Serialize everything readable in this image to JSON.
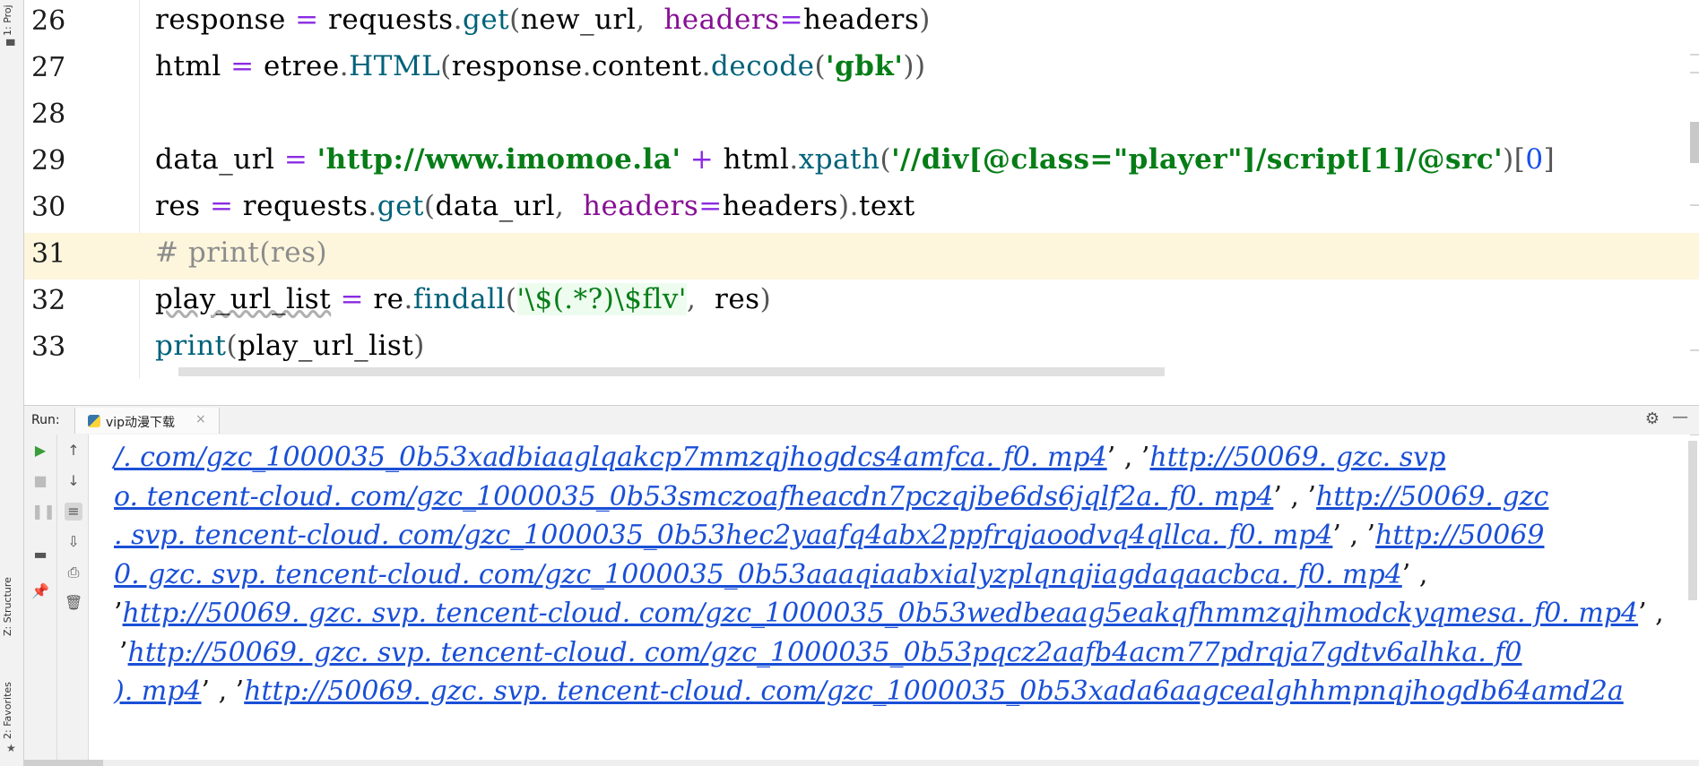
{
  "side_panel": {
    "project_label": "1: Proj",
    "structure_label": "Z: Structure",
    "favorites_label": "2: Favorites"
  },
  "editor": {
    "lines": [
      {
        "num": "26",
        "tokens": [
          {
            "t": "response ",
            "c": "kw"
          },
          {
            "t": "= ",
            "c": "op"
          },
          {
            "t": "requests",
            "c": "kw"
          },
          {
            "t": ".",
            "c": "punc"
          },
          {
            "t": "get",
            "c": "fn"
          },
          {
            "t": "(",
            "c": "punc"
          },
          {
            "t": "new_url",
            "c": "kw"
          },
          {
            "t": ",  ",
            "c": "punc"
          },
          {
            "t": "headers",
            "c": "param"
          },
          {
            "t": "=",
            "c": "op"
          },
          {
            "t": "headers",
            "c": "kw"
          },
          {
            "t": ")",
            "c": "punc"
          }
        ]
      },
      {
        "num": "27",
        "tokens": [
          {
            "t": "html ",
            "c": "kw"
          },
          {
            "t": "= ",
            "c": "op"
          },
          {
            "t": "etree",
            "c": "kw"
          },
          {
            "t": ".",
            "c": "punc"
          },
          {
            "t": "HTML",
            "c": "fn"
          },
          {
            "t": "(",
            "c": "punc"
          },
          {
            "t": "response",
            "c": "kw"
          },
          {
            "t": ".",
            "c": "punc"
          },
          {
            "t": "content",
            "c": "kw"
          },
          {
            "t": ".",
            "c": "punc"
          },
          {
            "t": "decode",
            "c": "fn"
          },
          {
            "t": "(",
            "c": "punc"
          },
          {
            "t": "'gbk'",
            "c": "str"
          },
          {
            "t": "))",
            "c": "punc"
          }
        ]
      },
      {
        "num": "28",
        "tokens": []
      },
      {
        "num": "29",
        "tokens": [
          {
            "t": "data_url ",
            "c": "kw"
          },
          {
            "t": "= ",
            "c": "op"
          },
          {
            "t": "'http://www.imomoe.la'",
            "c": "str"
          },
          {
            "t": " + ",
            "c": "op"
          },
          {
            "t": "html",
            "c": "kw"
          },
          {
            "t": ".",
            "c": "punc"
          },
          {
            "t": "xpath",
            "c": "fn"
          },
          {
            "t": "(",
            "c": "punc"
          },
          {
            "t": "'//div[@class=\"player\"]/script[1]/@src'",
            "c": "str"
          },
          {
            "t": ")[",
            "c": "punc"
          },
          {
            "t": "0",
            "c": "num"
          },
          {
            "t": "]",
            "c": "punc"
          }
        ]
      },
      {
        "num": "30",
        "tokens": [
          {
            "t": "res ",
            "c": "kw"
          },
          {
            "t": "= ",
            "c": "op"
          },
          {
            "t": "requests",
            "c": "kw"
          },
          {
            "t": ".",
            "c": "punc"
          },
          {
            "t": "get",
            "c": "fn"
          },
          {
            "t": "(",
            "c": "punc"
          },
          {
            "t": "data_url",
            "c": "kw"
          },
          {
            "t": ",  ",
            "c": "punc"
          },
          {
            "t": "headers",
            "c": "param"
          },
          {
            "t": "=",
            "c": "op"
          },
          {
            "t": "headers",
            "c": "kw"
          },
          {
            "t": ")",
            "c": "punc"
          },
          {
            "t": ".",
            "c": "punc"
          },
          {
            "t": "text",
            "c": "kw"
          }
        ]
      },
      {
        "num": "31",
        "current": true,
        "tokens": [
          {
            "t": "# print(res)",
            "c": "cmt"
          }
        ]
      },
      {
        "num": "32",
        "tokens": [
          {
            "t": "play_url_list",
            "c": "kw squig"
          },
          {
            "t": " = ",
            "c": "op"
          },
          {
            "t": "re",
            "c": "kw"
          },
          {
            "t": ".",
            "c": "punc"
          },
          {
            "t": "findall",
            "c": "fn"
          },
          {
            "t": "(",
            "c": "punc"
          },
          {
            "t": "'\\$(.*?)\\$flv'",
            "c": "re"
          },
          {
            "t": ",  ",
            "c": "punc"
          },
          {
            "t": "res",
            "c": "kw"
          },
          {
            "t": ")",
            "c": "punc"
          }
        ]
      },
      {
        "num": "33",
        "tokens": [
          {
            "t": "print",
            "c": "fn"
          },
          {
            "t": "(",
            "c": "punc"
          },
          {
            "t": "play_url_list",
            "c": "kw"
          },
          {
            "t": ")",
            "c": "punc"
          }
        ]
      }
    ]
  },
  "run_panel": {
    "label": "Run:",
    "tab_name": "vip动漫下载",
    "tab_close": "×",
    "gear": "⚙",
    "minimize": "—"
  },
  "console": {
    "lines": [
      {
        "x": 28,
        "parts": [
          {
            "t": "/. com/gzc_1000035_0b53xadbiaaglqakcp7mmzqjhogdcs4amfca. f0. mp4",
            "c": "link"
          },
          {
            "t": "’ , ’",
            "c": "sep"
          },
          {
            "t": "http://50069. gzc. svp",
            "c": "link"
          }
        ]
      },
      {
        "x": 28,
        "parts": [
          {
            "t": "o. tencent-cloud. com/gzc_1000035_0b53smczoafheacdn7pczqjbe6ds6jqlf2a. f0. mp4",
            "c": "link"
          },
          {
            "t": "’ , ’",
            "c": "sep"
          },
          {
            "t": "http://50069. gzc",
            "c": "link"
          }
        ]
      },
      {
        "x": 28,
        "parts": [
          {
            "t": ". svp. tencent-cloud. com/gzc_1000035_0b53hec2yaafq4abx2ppfrqjaoodvq4qllca. f0. mp4",
            "c": "link"
          },
          {
            "t": "’ , ’",
            "c": "sep"
          },
          {
            "t": "http://50069",
            "c": "link"
          }
        ]
      },
      {
        "x": 28,
        "parts": [
          {
            "t": "0. gzc. svp. tencent-cloud. com/gzc_1000035_0b53aaaqiaabxialyzplqnqjiagdaqaacbca. f0. mp4",
            "c": "link"
          },
          {
            "t": "’ ,",
            "c": "sep"
          }
        ]
      },
      {
        "x": 28,
        "parts": [
          {
            "t": "’",
            "c": "sep"
          },
          {
            "t": "http://50069. gzc. svp. tencent-cloud. com/gzc_1000035_0b53wedbeaag5eakqfhmmzqjhmodckyqmesa. f0. mp4",
            "c": "link"
          },
          {
            "t": "’ ,",
            "c": "sep"
          }
        ]
      },
      {
        "x": 34,
        "parts": [
          {
            "t": "’",
            "c": "sep"
          },
          {
            "t": "http://50069. gzc. svp. tencent-cloud. com/gzc_1000035_0b53pqcz2aafb4acm77pdrqja7gdtv6alhka. f0",
            "c": "link"
          }
        ]
      },
      {
        "x": 28,
        "parts": [
          {
            "t": "). mp4",
            "c": "link"
          },
          {
            "t": "’ , ’",
            "c": "sep"
          },
          {
            "t": "http://50069. gzc. svp. tencent-cloud. com/gzc_1000035_0b53xada6aagcealghhmpnqjhogdb64amd2a",
            "c": "link"
          }
        ]
      }
    ]
  },
  "colors": {
    "current_line": "#fdf6dd",
    "link": "#1a4fd6",
    "string": "#067d17",
    "function": "#00627a",
    "param": "#871094"
  }
}
